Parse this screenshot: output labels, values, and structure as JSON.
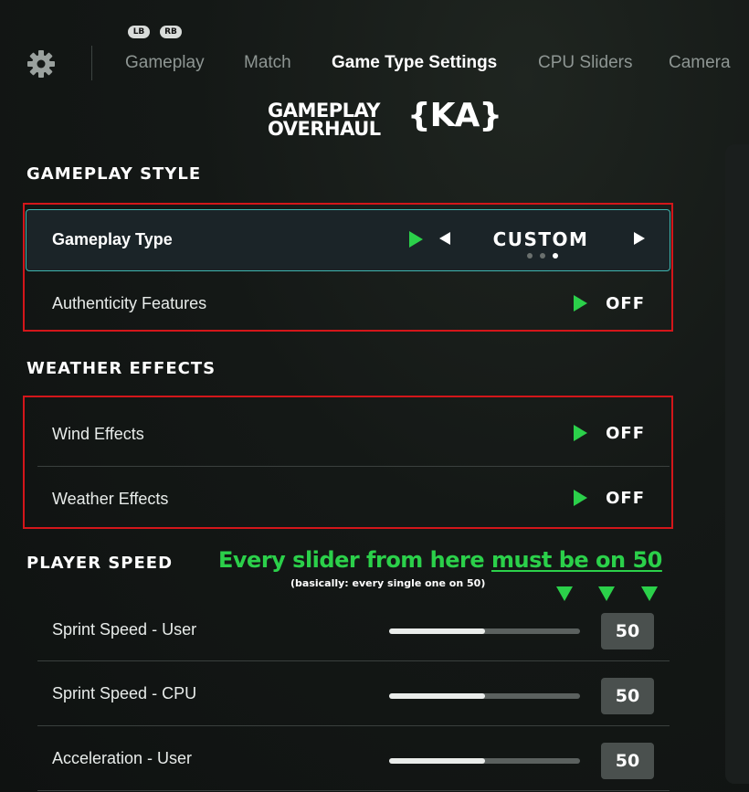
{
  "header": {
    "bumpers": {
      "left": "LB",
      "right": "RB"
    },
    "settings_icon": "gear-icon",
    "tabs": [
      {
        "label": "Gameplay",
        "active": false
      },
      {
        "label": "Match",
        "active": false
      },
      {
        "label": "Game Type Settings",
        "active": true
      },
      {
        "label": "CPU Sliders",
        "active": false
      },
      {
        "label": "Camera",
        "active": false
      }
    ]
  },
  "logo": {
    "line1": "GAMEPLAY",
    "line2": "OVERHAUL",
    "mark": "{KA}"
  },
  "sections": {
    "gameplay_style": {
      "title": "GAMEPLAY STYLE",
      "gameplay_type": {
        "label": "Gameplay Type",
        "value": "CUSTOM",
        "page_dots": 3,
        "active_dot": 3
      },
      "authenticity": {
        "label": "Authenticity Features",
        "value": "OFF"
      }
    },
    "weather_effects": {
      "title": "WEATHER EFFECTS",
      "wind": {
        "label": "Wind Effects",
        "value": "OFF"
      },
      "weather": {
        "label": "Weather Effects",
        "value": "OFF"
      }
    },
    "player_speed": {
      "title": "PLAYER SPEED",
      "annotation": {
        "prefix": "Every slider from here ",
        "emphasis": "must be on 50",
        "note": "(basically: every single one on 50)"
      },
      "sliders": [
        {
          "label": "Sprint Speed - User",
          "value": "50",
          "fraction": 0.5
        },
        {
          "label": "Sprint Speed - CPU",
          "value": "50",
          "fraction": 0.5
        },
        {
          "label": "Acceleration - User",
          "value": "50",
          "fraction": 0.5
        }
      ]
    }
  },
  "colors": {
    "accent_green": "#2bd04a",
    "highlight_red": "#d3161a",
    "focus_teal": "#3fb6b0"
  }
}
